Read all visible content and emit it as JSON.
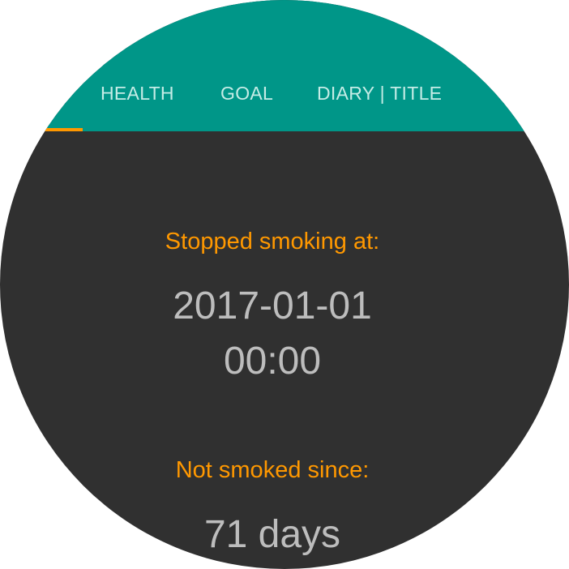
{
  "tabs": [
    {
      "label": "HEALTH",
      "selected": true
    },
    {
      "label": "GOAL",
      "selected": false
    },
    {
      "label": "DIARY | TITLE",
      "selected": false
    }
  ],
  "colors": {
    "tabbar": "#009688",
    "background": "#303030",
    "accent": "#ff9800",
    "value_text": "#bdbdbd"
  },
  "stopped": {
    "label": "Stopped smoking at:",
    "date": "2017-01-01",
    "time": "00:00"
  },
  "since": {
    "label": "Not smoked since:",
    "value": "71 days"
  }
}
